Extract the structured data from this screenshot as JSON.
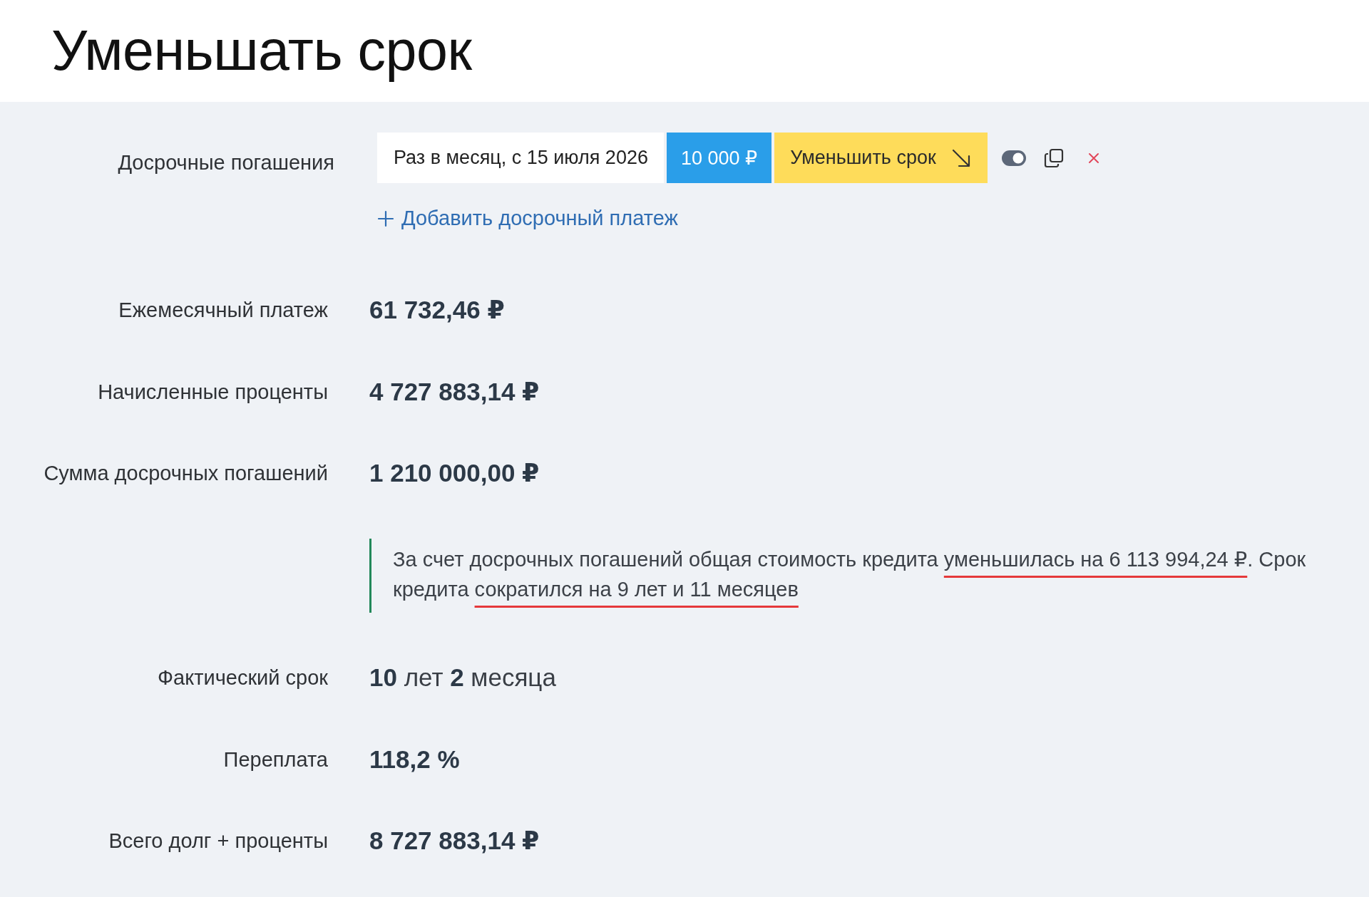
{
  "title": "Уменьшать срок",
  "early_payments": {
    "label": "Досрочные погашения",
    "items": [
      {
        "period": "Раз в месяц, с 15 июля 2026",
        "amount": "10 000 ₽",
        "mode": "Уменьшить срок",
        "enabled": true
      }
    ],
    "add_link": "Добавить досрочный платеж"
  },
  "results": [
    {
      "kind": "metric",
      "label": "Ежемесячный платеж",
      "value": "61 732,46 ₽"
    },
    {
      "kind": "metric",
      "label": "Начисленные проценты",
      "value": "4 727 883,14 ₽"
    },
    {
      "kind": "metric",
      "label": "Сумма досрочных погашений",
      "value": "1 210 000,00 ₽"
    },
    {
      "kind": "note",
      "segments": [
        {
          "text": "За счет досрочных погашений общая стоимость кредита ",
          "underlined": false
        },
        {
          "text": "уменьшилась на 6 113 994,24 ₽",
          "underlined": true
        },
        {
          "text": ". Срок кредита ",
          "underlined": false
        },
        {
          "text": "сократился на 9 лет и 11 месяцев",
          "underlined": true
        }
      ]
    },
    {
      "kind": "metric",
      "label": "Фактический срок",
      "value": "**10** лет **2** месяца"
    },
    {
      "kind": "metric",
      "label": "Переплата",
      "value": "118,2 %"
    },
    {
      "kind": "metric",
      "label": "Всего долг + проценты",
      "value": "8 727 883,14 ₽"
    }
  ]
}
